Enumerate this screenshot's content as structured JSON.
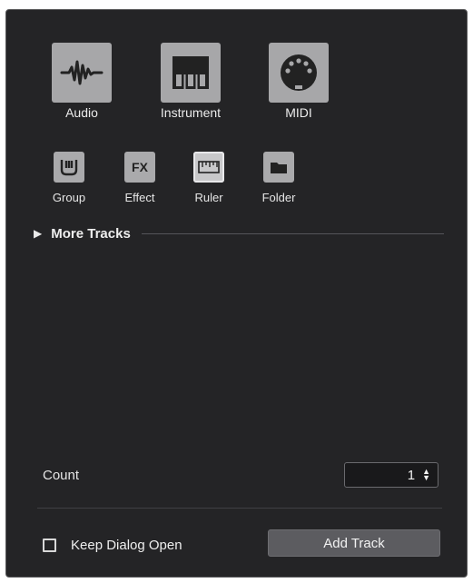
{
  "track_types": {
    "primary": [
      {
        "label": "Audio",
        "icon": "audio-waveform-icon"
      },
      {
        "label": "Instrument",
        "icon": "piano-keys-icon"
      },
      {
        "label": "MIDI",
        "icon": "midi-connector-icon"
      }
    ],
    "secondary": [
      {
        "label": "Group",
        "icon": "group-channel-icon"
      },
      {
        "label": "Effect",
        "icon": "fx-icon",
        "glyph": "FX"
      },
      {
        "label": "Ruler",
        "icon": "ruler-icon",
        "selected": true
      },
      {
        "label": "Folder",
        "icon": "folder-icon"
      }
    ]
  },
  "more_tracks": {
    "label": "More Tracks",
    "expanded": false
  },
  "count": {
    "label": "Count",
    "value": "1"
  },
  "footer": {
    "keep_open_label": "Keep Dialog Open",
    "keep_open_checked": false,
    "add_button_label": "Add Track"
  },
  "colors": {
    "dialog_bg": "#242426",
    "tile_bg": "#a7a7a9",
    "button_bg": "#5c5c60"
  }
}
